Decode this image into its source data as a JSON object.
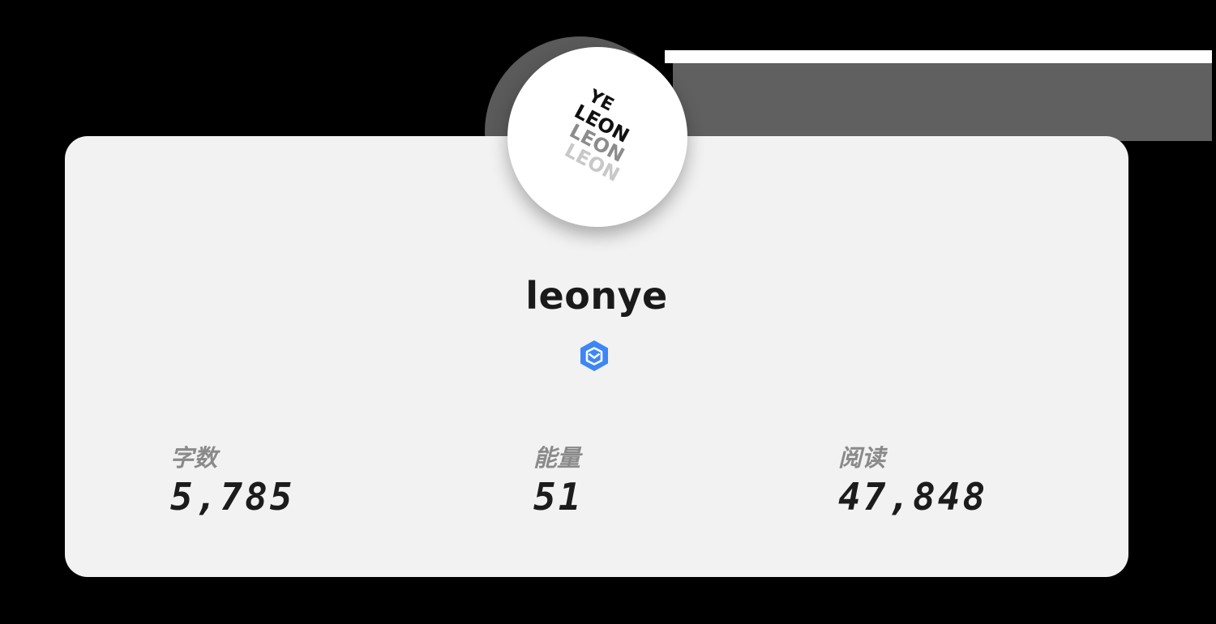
{
  "profile": {
    "username": "leonye",
    "avatar_icon": "leon-ye-logo-icon",
    "avatar_lines": [
      "YE",
      "LEON",
      "LEON",
      "LEON"
    ],
    "badge_icon": "verified-creator-badge-icon",
    "badge_color": "#3d86f6"
  },
  "stats": [
    {
      "label": "字数",
      "value": "5,785"
    },
    {
      "label": "能量",
      "value": "51"
    },
    {
      "label": "阅读",
      "value": "47,848"
    }
  ],
  "colors": {
    "card_background": "#f2f2f2",
    "page_background": "#000000",
    "label_color": "#8a8a8a",
    "value_color": "#1c1c1c"
  }
}
